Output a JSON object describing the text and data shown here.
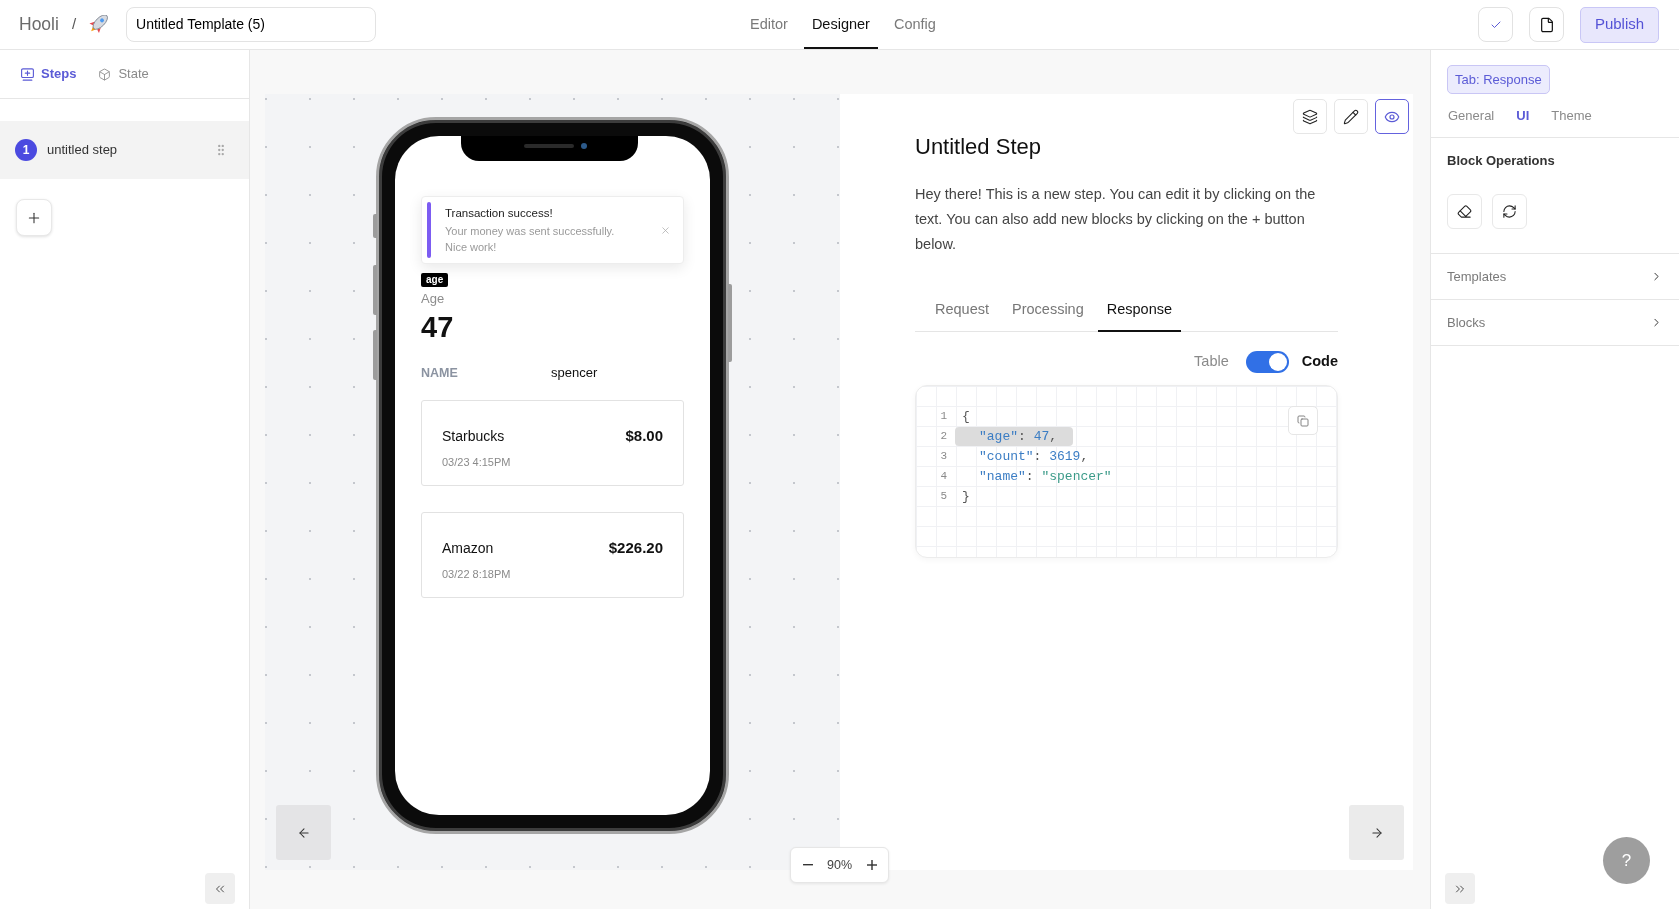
{
  "header": {
    "brand": "Hooli",
    "separator": "/",
    "template_name": "Untitled Template (5)",
    "tabs": [
      {
        "label": "Editor",
        "selected": false
      },
      {
        "label": "Designer",
        "selected": true
      },
      {
        "label": "Config",
        "selected": false
      }
    ],
    "actions": [
      {
        "kind": "check"
      },
      {
        "kind": "file"
      }
    ],
    "publish_label": "Publish"
  },
  "sidebar": {
    "tabs": [
      {
        "kind": "steps",
        "label": "Steps",
        "selected": true
      },
      {
        "kind": "state",
        "label": "State",
        "selected": false
      }
    ],
    "steps": [
      {
        "number": "1",
        "label": "untitled step",
        "selected": true
      }
    ]
  },
  "preview": {
    "toast": {
      "title": "Transaction success!",
      "message": "Your money was sent successfully. Nice work!"
    },
    "tag": "age",
    "stat": {
      "label": "Age",
      "value": "47"
    },
    "field": {
      "label": "NAME",
      "value": "spencer"
    },
    "transactions": [
      {
        "merchant": "Starbucks",
        "amount": "$8.00",
        "date": "03/23 4:15PM"
      },
      {
        "merchant": "Amazon",
        "amount": "$226.20",
        "date": "03/22 8:18PM"
      }
    ]
  },
  "zoom": {
    "value": "90%"
  },
  "step": {
    "toolbar": [
      {
        "kind": "layers",
        "selected": false
      },
      {
        "kind": "edit",
        "selected": false
      },
      {
        "kind": "preview",
        "selected": true
      }
    ],
    "title": "Untitled Step",
    "description": "Hey there! This is a new step. You can edit it by clicking on the text. You can also add new blocks by clicking on the + button below.",
    "tabs": [
      {
        "label": "Request",
        "selected": false
      },
      {
        "label": "Processing",
        "selected": false
      },
      {
        "label": "Response",
        "selected": true
      }
    ],
    "view_toggle": {
      "off_label": "Table",
      "on_label": "Code",
      "on": true
    },
    "code": [
      {
        "number": "1",
        "highlighted": false,
        "tokens": [
          {
            "kind": "punct",
            "text": "{"
          }
        ]
      },
      {
        "number": "2",
        "highlighted": true,
        "tokens": [
          {
            "kind": "key",
            "text": "\"age\""
          },
          {
            "kind": "punct",
            "text": ": "
          },
          {
            "kind": "number",
            "text": "47"
          },
          {
            "kind": "punct",
            "text": ","
          }
        ]
      },
      {
        "number": "3",
        "highlighted": false,
        "tokens": [
          {
            "kind": "key",
            "text": "\"count\""
          },
          {
            "kind": "punct",
            "text": ": "
          },
          {
            "kind": "number",
            "text": "3619"
          },
          {
            "kind": "punct",
            "text": ","
          }
        ]
      },
      {
        "number": "4",
        "highlighted": false,
        "tokens": [
          {
            "kind": "key",
            "text": "\"name\""
          },
          {
            "kind": "punct",
            "text": ": "
          },
          {
            "kind": "string",
            "text": "\"spencer\""
          }
        ]
      },
      {
        "number": "5",
        "highlighted": false,
        "tokens": [
          {
            "kind": "punct",
            "text": "}"
          }
        ]
      }
    ]
  },
  "inspector": {
    "badge": "Tab: Response",
    "tabs": [
      {
        "label": "General",
        "selected": false
      },
      {
        "label": "UI",
        "selected": true
      },
      {
        "label": "Theme",
        "selected": false
      }
    ],
    "section_title": "Block Operations",
    "operations": [
      {
        "kind": "erase"
      },
      {
        "kind": "refresh"
      }
    ],
    "panels": [
      {
        "label": "Templates",
        "expanded": false
      },
      {
        "label": "Blocks",
        "expanded": false
      }
    ]
  },
  "help": {
    "label": "?"
  }
}
